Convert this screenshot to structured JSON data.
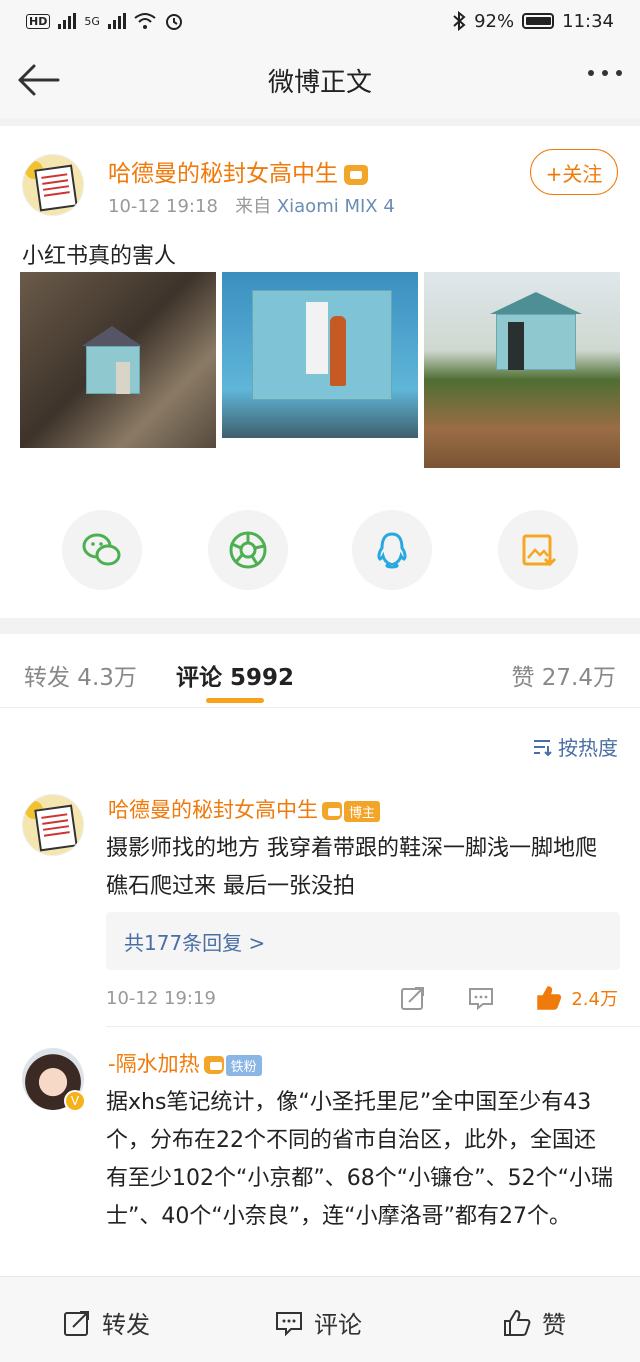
{
  "status_bar": {
    "network": "5G",
    "battery": "92%",
    "time": "11:34"
  },
  "nav": {
    "title": "微博正文"
  },
  "post": {
    "author": "哈德曼的秘封女高中生",
    "time": "10-12 19:18",
    "from_label": "来自",
    "device": "Xiaomi MIX 4",
    "follow_label": "+关注",
    "text": "小红书真的害人",
    "photo_count": 3
  },
  "share": {
    "icons": [
      "wechat-icon",
      "moments-icon",
      "qq-icon",
      "save-image-icon"
    ],
    "colors": {
      "green": "#4caf50",
      "blue": "#29a8e0",
      "orange": "#f5a623"
    }
  },
  "tabs": {
    "repost": "转发 4.3万",
    "comment": "评论 5992",
    "like": "赞 27.4万"
  },
  "sort_label": "按热度",
  "comments": [
    {
      "user": "哈德曼的秘封女高中生",
      "tag": "博主",
      "text": "摄影师找的地方 我穿着带跟的鞋深一脚浅一脚地爬礁石爬过来 最后一张没拍",
      "replies": "共177条回复 >",
      "time": "10-12 19:19",
      "likes": "2.4万"
    },
    {
      "user": "-隔水加热",
      "tag": "铁粉",
      "text": "据xhs笔记统计，像“小圣托里尼”全中国至少有43个，分布在22个不同的省市自治区，此外，全国还有至少102个“小京都”、68个“小镰仓”、52个“小瑞士”、40个“小奈良”，连“小摩洛哥”都有27个。"
    }
  ],
  "bottom_bar": {
    "repost": "转发",
    "comment": "评论",
    "like": "赞"
  },
  "accent": "#f07a0b"
}
